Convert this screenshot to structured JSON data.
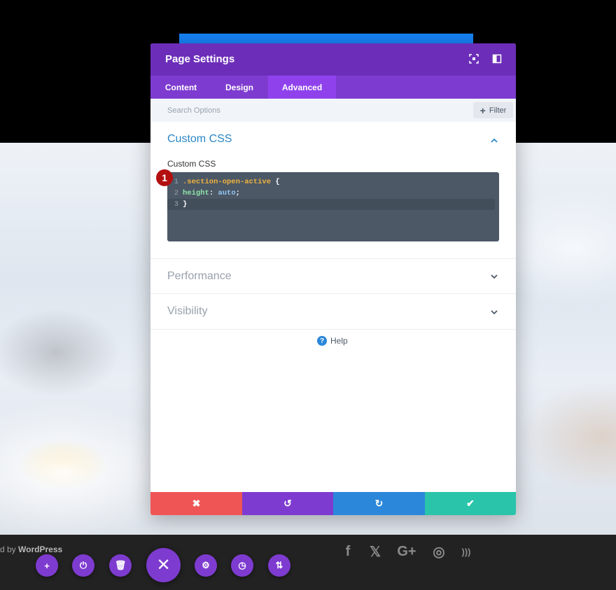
{
  "background": {
    "footer_credit_prefix": "d by",
    "footer_credit_brand": "WordPress",
    "social_icons": [
      "facebook-icon",
      "twitter-icon",
      "google-plus-icon",
      "instagram-icon",
      "rss-icon"
    ],
    "social_glyphs": [
      "f",
      "𝕏",
      "G+",
      "◎",
      ")))"
    ]
  },
  "builder_toolbar": {
    "buttons": [
      {
        "name": "add-icon",
        "glyph": "+"
      },
      {
        "name": "power-icon",
        "glyph": "⏻"
      },
      {
        "name": "trash-icon",
        "glyph": "🗑"
      },
      {
        "name": "settings-icon",
        "glyph": "⚙"
      },
      {
        "name": "history-icon",
        "glyph": "◷"
      },
      {
        "name": "sort-icon",
        "glyph": "⇅"
      }
    ],
    "close_glyph": "✕"
  },
  "modal": {
    "title": "Page Settings",
    "tabs": [
      {
        "label": "Content",
        "active": false
      },
      {
        "label": "Design",
        "active": false
      },
      {
        "label": "Advanced",
        "active": true
      }
    ],
    "search": {
      "placeholder": "Search Options",
      "value": ""
    },
    "filter_label": "Filter",
    "sections": {
      "custom_css": {
        "title": "Custom CSS",
        "field_label": "Custom CSS",
        "marker": "1",
        "code_lines": [
          {
            "number": "1",
            "selector": ".section-open-active",
            "punct": " {"
          },
          {
            "number": "2",
            "property": "height",
            "colon": ": ",
            "value": "auto",
            "end": ";"
          },
          {
            "number": "3",
            "punct": "}"
          }
        ]
      },
      "performance": {
        "title": "Performance"
      },
      "visibility": {
        "title": "Visibility"
      }
    },
    "help_label": "Help",
    "actions": [
      {
        "name": "discard-button",
        "glyph": "✖",
        "color": "#ef5555"
      },
      {
        "name": "undo-button",
        "glyph": "↺",
        "color": "#7e3bd0"
      },
      {
        "name": "redo-button",
        "glyph": "↻",
        "color": "#2b87da"
      },
      {
        "name": "save-button",
        "glyph": "✔",
        "color": "#29c4a9"
      }
    ]
  },
  "colors": {
    "header": "#6c2eb9",
    "tabs": "#7e3bd0",
    "active_tab": "#8f42ec",
    "accent_blue": "#1683f6"
  }
}
